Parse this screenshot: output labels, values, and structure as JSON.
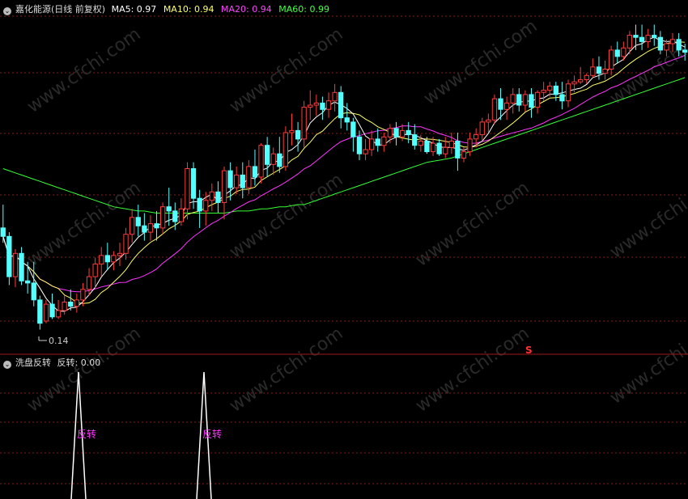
{
  "main_panel": {
    "title": "嘉化能源(日线 前复权)",
    "indicators": [
      {
        "label": "MA5: 0.97",
        "color": "#ffffff"
      },
      {
        "label": "MA10: 0.94",
        "color": "#ffff66"
      },
      {
        "label": "MA20: 0.94",
        "color": "#ff44ff"
      },
      {
        "label": "MA60: 0.99",
        "color": "#44ff44"
      }
    ],
    "low_marker": "0.14",
    "signal_marker": "S"
  },
  "sub_panel": {
    "title": "洗盘反转",
    "value_label": "反转: 0.00",
    "signal_label": "反转"
  },
  "watermark": "www.cfchi.com",
  "colors": {
    "up": "#ff3b3b",
    "down": "#54ffff",
    "ma5": "#ffffff",
    "ma10": "#ffff66",
    "ma20": "#ff33ff",
    "ma60": "#33ff33",
    "grid": "#8b1a1a",
    "signal_text": "#ff33ff"
  },
  "chart_data": {
    "type": "candlestick",
    "candles": [
      [
        0.62,
        0.73,
        0.58,
        0.55
      ],
      [
        0.58,
        0.6,
        0.39,
        0.35
      ],
      [
        0.39,
        0.52,
        0.5,
        0.34
      ],
      [
        0.5,
        0.53,
        0.37,
        0.35
      ],
      [
        0.37,
        0.46,
        0.36,
        0.31
      ],
      [
        0.36,
        0.46,
        0.28,
        0.25
      ],
      [
        0.28,
        0.3,
        0.17,
        0.14
      ],
      [
        0.18,
        0.28,
        0.26,
        0.17
      ],
      [
        0.26,
        0.31,
        0.2,
        0.19
      ],
      [
        0.2,
        0.28,
        0.23,
        0.19
      ],
      [
        0.23,
        0.3,
        0.27,
        0.21
      ],
      [
        0.27,
        0.33,
        0.25,
        0.23
      ],
      [
        0.25,
        0.31,
        0.28,
        0.22
      ],
      [
        0.28,
        0.36,
        0.33,
        0.25
      ],
      [
        0.33,
        0.43,
        0.39,
        0.3
      ],
      [
        0.39,
        0.48,
        0.45,
        0.33
      ],
      [
        0.45,
        0.53,
        0.49,
        0.39
      ],
      [
        0.49,
        0.55,
        0.46,
        0.42
      ],
      [
        0.46,
        0.51,
        0.49,
        0.42
      ],
      [
        0.49,
        0.55,
        0.5,
        0.44
      ],
      [
        0.5,
        0.62,
        0.59,
        0.47
      ],
      [
        0.59,
        0.71,
        0.67,
        0.55
      ],
      [
        0.67,
        0.73,
        0.63,
        0.58
      ],
      [
        0.63,
        0.69,
        0.6,
        0.56
      ],
      [
        0.6,
        0.68,
        0.64,
        0.56
      ],
      [
        0.64,
        0.7,
        0.62,
        0.56
      ],
      [
        0.62,
        0.74,
        0.72,
        0.59
      ],
      [
        0.72,
        0.81,
        0.7,
        0.63
      ],
      [
        0.7,
        0.74,
        0.65,
        0.61
      ],
      [
        0.65,
        0.76,
        0.71,
        0.63
      ],
      [
        0.71,
        0.93,
        0.9,
        0.66
      ],
      [
        0.9,
        0.93,
        0.76,
        0.71
      ],
      [
        0.76,
        0.8,
        0.7,
        0.62
      ],
      [
        0.7,
        0.79,
        0.75,
        0.63
      ],
      [
        0.75,
        0.83,
        0.79,
        0.7
      ],
      [
        0.79,
        0.84,
        0.74,
        0.69
      ],
      [
        0.74,
        0.91,
        0.89,
        0.66
      ],
      [
        0.89,
        0.93,
        0.81,
        0.75
      ],
      [
        0.81,
        0.91,
        0.87,
        0.78
      ],
      [
        0.87,
        0.93,
        0.81,
        0.76
      ],
      [
        0.81,
        0.94,
        0.91,
        0.78
      ],
      [
        0.91,
        0.99,
        0.86,
        0.82
      ],
      [
        0.86,
        1.02,
        1.01,
        0.83
      ],
      [
        1.01,
        1.05,
        0.92,
        0.86
      ],
      [
        0.92,
        1.0,
        0.97,
        0.87
      ],
      [
        0.97,
        1.05,
        0.91,
        0.88
      ],
      [
        0.91,
        1.1,
        1.07,
        0.89
      ],
      [
        1.07,
        1.16,
        1.08,
        1.01
      ],
      [
        1.08,
        1.12,
        1.04,
        0.98
      ],
      [
        1.04,
        1.22,
        1.19,
        1.0
      ],
      [
        1.19,
        1.27,
        1.2,
        1.13
      ],
      [
        1.2,
        1.25,
        1.21,
        1.15
      ],
      [
        1.21,
        1.24,
        1.18,
        1.13
      ],
      [
        1.18,
        1.26,
        1.22,
        1.14
      ],
      [
        1.22,
        1.3,
        1.26,
        1.17
      ],
      [
        1.26,
        1.29,
        1.14,
        1.09
      ],
      [
        1.14,
        1.21,
        1.12,
        1.08
      ],
      [
        1.12,
        1.14,
        1.05,
        0.98
      ],
      [
        1.05,
        1.08,
        0.97,
        0.94
      ],
      [
        0.97,
        1.04,
        0.99,
        0.94
      ],
      [
        0.99,
        1.08,
        1.04,
        0.96
      ],
      [
        1.04,
        1.09,
        1.01,
        0.98
      ],
      [
        1.01,
        1.07,
        1.05,
        0.98
      ],
      [
        1.05,
        1.11,
        1.09,
        1.02
      ],
      [
        1.09,
        1.12,
        1.05,
        1.01
      ],
      [
        1.05,
        1.11,
        1.08,
        1.03
      ],
      [
        1.08,
        1.12,
        1.06,
        1.02
      ],
      [
        1.06,
        1.11,
        1.01,
        0.99
      ],
      [
        1.01,
        1.06,
        1.03,
        0.98
      ],
      [
        1.03,
        1.05,
        0.98,
        0.97
      ],
      [
        0.98,
        1.05,
        1.02,
        0.96
      ],
      [
        1.02,
        1.04,
        0.97,
        0.96
      ],
      [
        0.97,
        1.05,
        1.0,
        0.95
      ],
      [
        1.0,
        1.07,
        1.03,
        0.97
      ],
      [
        1.03,
        1.07,
        0.95,
        0.89
      ],
      [
        0.95,
        1.0,
        0.98,
        0.93
      ],
      [
        0.98,
        1.07,
        1.04,
        0.96
      ],
      [
        1.04,
        1.09,
        1.06,
        1.0
      ],
      [
        1.06,
        1.14,
        1.12,
        1.03
      ],
      [
        1.12,
        1.16,
        1.13,
        1.07
      ],
      [
        1.13,
        1.25,
        1.23,
        1.11
      ],
      [
        1.23,
        1.28,
        1.18,
        1.13
      ],
      [
        1.18,
        1.24,
        1.21,
        1.13
      ],
      [
        1.21,
        1.28,
        1.25,
        1.16
      ],
      [
        1.25,
        1.28,
        1.2,
        1.17
      ],
      [
        1.2,
        1.27,
        1.25,
        1.17
      ],
      [
        1.25,
        1.28,
        1.19,
        1.14
      ],
      [
        1.19,
        1.27,
        1.26,
        1.16
      ],
      [
        1.26,
        1.31,
        1.27,
        1.22
      ],
      [
        1.27,
        1.31,
        1.29,
        1.24
      ],
      [
        1.29,
        1.31,
        1.25,
        1.22
      ],
      [
        1.25,
        1.31,
        1.22,
        1.18
      ],
      [
        1.22,
        1.32,
        1.3,
        1.19
      ],
      [
        1.3,
        1.34,
        1.31,
        1.26
      ],
      [
        1.31,
        1.38,
        1.32,
        1.3
      ],
      [
        1.32,
        1.35,
        1.34,
        1.3
      ],
      [
        1.34,
        1.42,
        1.38,
        1.33
      ],
      [
        1.38,
        1.43,
        1.35,
        1.32
      ],
      [
        1.35,
        1.41,
        1.37,
        1.32
      ],
      [
        1.37,
        1.48,
        1.46,
        1.34
      ],
      [
        1.46,
        1.5,
        1.43,
        1.4
      ],
      [
        1.43,
        1.5,
        1.47,
        1.41
      ],
      [
        1.47,
        1.55,
        1.53,
        1.44
      ],
      [
        1.53,
        1.58,
        1.52,
        1.46
      ],
      [
        1.52,
        1.58,
        1.5,
        1.46
      ],
      [
        1.5,
        1.56,
        1.53,
        1.47
      ],
      [
        1.53,
        1.58,
        1.52,
        1.48
      ],
      [
        1.52,
        1.55,
        1.46,
        1.44
      ],
      [
        1.46,
        1.51,
        1.49,
        1.43
      ],
      [
        1.49,
        1.54,
        1.51,
        1.45
      ],
      [
        1.51,
        1.54,
        1.46,
        1.43
      ],
      [
        1.46,
        1.49,
        1.45,
        1.41
      ]
    ],
    "ma60": [
      0.9,
      0.89,
      0.88,
      0.87,
      0.86,
      0.85,
      0.84,
      0.83,
      0.82,
      0.81,
      0.8,
      0.79,
      0.78,
      0.77,
      0.76,
      0.75,
      0.74,
      0.73,
      0.72,
      0.715,
      0.71,
      0.705,
      0.7,
      0.7,
      0.695,
      0.69,
      0.69,
      0.69,
      0.69,
      0.69,
      0.69,
      0.69,
      0.69,
      0.69,
      0.69,
      0.69,
      0.69,
      0.695,
      0.7,
      0.7,
      0.7,
      0.705,
      0.71,
      0.71,
      0.715,
      0.72,
      0.72,
      0.725,
      0.73,
      0.73,
      0.74,
      0.75,
      0.76,
      0.77,
      0.78,
      0.79,
      0.8,
      0.81,
      0.82,
      0.83,
      0.84,
      0.85,
      0.86,
      0.87,
      0.88,
      0.89,
      0.9,
      0.91,
      0.92,
      0.93,
      0.935,
      0.94,
      0.945,
      0.95,
      0.96,
      0.97,
      0.98,
      0.99,
      1.0,
      1.01,
      1.02,
      1.03,
      1.04,
      1.05,
      1.06,
      1.07,
      1.08,
      1.09,
      1.1,
      1.11,
      1.12,
      1.13,
      1.14,
      1.15,
      1.16,
      1.17,
      1.18,
      1.19,
      1.2,
      1.21,
      1.22,
      1.23,
      1.24,
      1.25,
      1.26,
      1.27,
      1.28,
      1.29,
      1.3,
      1.31,
      1.32,
      1.33
    ],
    "signal_bars": [
      13,
      35
    ],
    "signal_value_peak": 1,
    "signal_current": 0.0,
    "signal_s_bar": 90
  }
}
